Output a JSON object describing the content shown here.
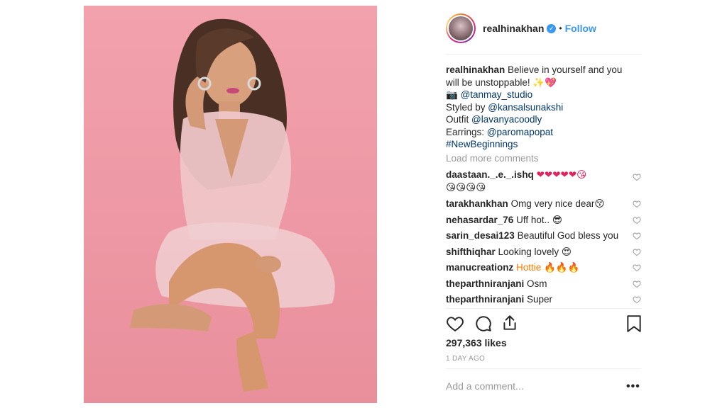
{
  "post": {
    "username": "realhinakhan",
    "follow_label": "Follow",
    "dot": "•",
    "caption": {
      "user": "realhinakhan",
      "text_line1": "Believe in yourself and you",
      "text_line2": "will be unstoppable! ✨💖",
      "camera_emoji": "📷",
      "photo_credit": "@tanmay_studio",
      "styled_prefix": "Styled by ",
      "stylist": "@kansalsunakshi",
      "outfit_prefix": "Outfit ",
      "outfit": "@lavanyacoodly",
      "earrings_prefix": "Earrings: ",
      "earrings": "@paromapopat",
      "hashtag": "#NewBeginnings"
    },
    "load_more": "Load more comments",
    "comments": [
      {
        "user": "daastaan._.e._.ishq",
        "text": "❤❤❤❤❤😘",
        "text2": "😘😘😘😘"
      },
      {
        "user": "tarakhankhan",
        "text": "Omg very nice dear😚"
      },
      {
        "user": "nehasardar_76",
        "text": "Uff hot.. 😎"
      },
      {
        "user": "sarin_desai123",
        "text": "Beautiful God bless you"
      },
      {
        "user": "shifthiqhar",
        "text": "Looking lovely 😍"
      },
      {
        "user": "manucreationz",
        "text": "Hottie 🔥🔥🔥"
      },
      {
        "user": "theparthniranjani",
        "text": "Osm"
      },
      {
        "user": "theparthniranjani",
        "text": "Super"
      }
    ],
    "likes": "297,363 likes",
    "time": "1 DAY AGO",
    "add_comment_placeholder": "Add a comment...",
    "more_label": "•••"
  },
  "icons": {
    "verified": "verified-badge-icon",
    "like": "heart-icon",
    "comment": "comment-bubble-icon",
    "share": "share-icon",
    "save": "bookmark-icon"
  },
  "colors": {
    "accent": "#3897f0",
    "link": "#003569",
    "photo_background": "#ef9ca8"
  }
}
